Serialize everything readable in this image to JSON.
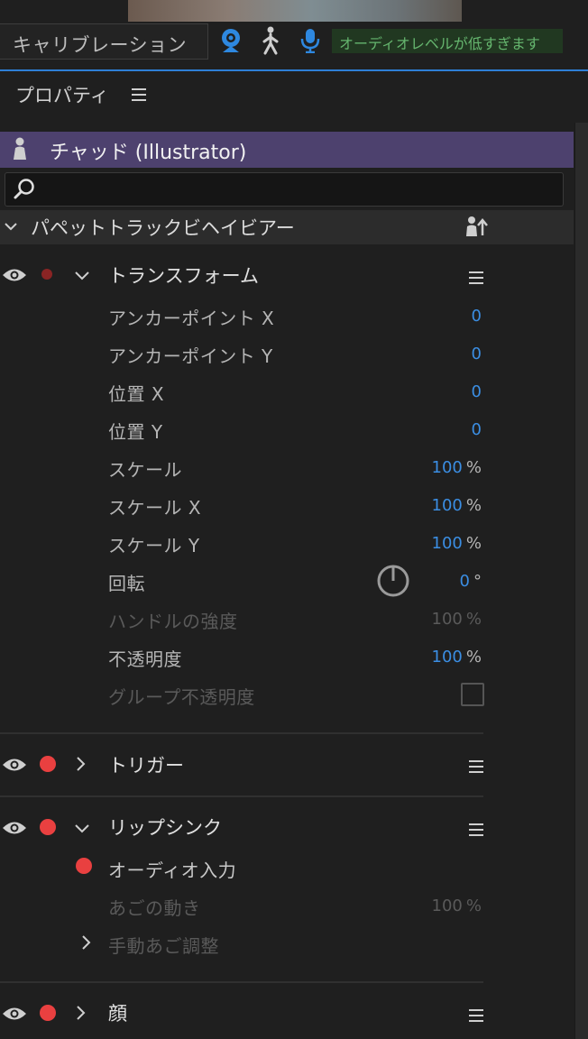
{
  "topbar": {
    "calibration_label": "キャリブレーション",
    "audio_status": "オーディオレベルが低すぎます",
    "icons": [
      "webcam-icon",
      "body-tracker-icon",
      "microphone-icon"
    ]
  },
  "panel": {
    "title": "プロパティ",
    "puppet_name": "チャッド (Illustrator)",
    "search_placeholder": ""
  },
  "behaviors": {
    "title": "パペットトラックビヘイビアー"
  },
  "transform": {
    "title": "トランスフォーム",
    "props": [
      {
        "label": "アンカーポイント X",
        "value": "0",
        "unit": ""
      },
      {
        "label": "アンカーポイント Y",
        "value": "0",
        "unit": ""
      },
      {
        "label": "位置 X",
        "value": "0",
        "unit": ""
      },
      {
        "label": "位置 Y",
        "value": "0",
        "unit": ""
      },
      {
        "label": "スケール",
        "value": "100",
        "unit": "%"
      },
      {
        "label": "スケール X",
        "value": "100",
        "unit": "%"
      },
      {
        "label": "スケール Y",
        "value": "100",
        "unit": "%"
      },
      {
        "label": "回転",
        "value": "0",
        "unit": "°"
      },
      {
        "label": "ハンドルの強度",
        "value": "100",
        "unit": "%"
      },
      {
        "label": "不透明度",
        "value": "100",
        "unit": "%"
      },
      {
        "label": "グループ不透明度",
        "value": "",
        "unit": ""
      }
    ]
  },
  "trigger": {
    "title": "トリガー"
  },
  "lipsync": {
    "title": "リップシンク",
    "audio_input": "オーディオ入力",
    "jaw_motion": "あごの動き",
    "jaw_value": "100",
    "jaw_unit": "%",
    "manual_jaw": "手動あご調整"
  },
  "face": {
    "title": "顔"
  },
  "colors": {
    "accent_blue": "#3b8ee3",
    "puppet_bar": "#4d416e",
    "record_red": "#e94040",
    "audio_warning_green": "#65b56e"
  }
}
